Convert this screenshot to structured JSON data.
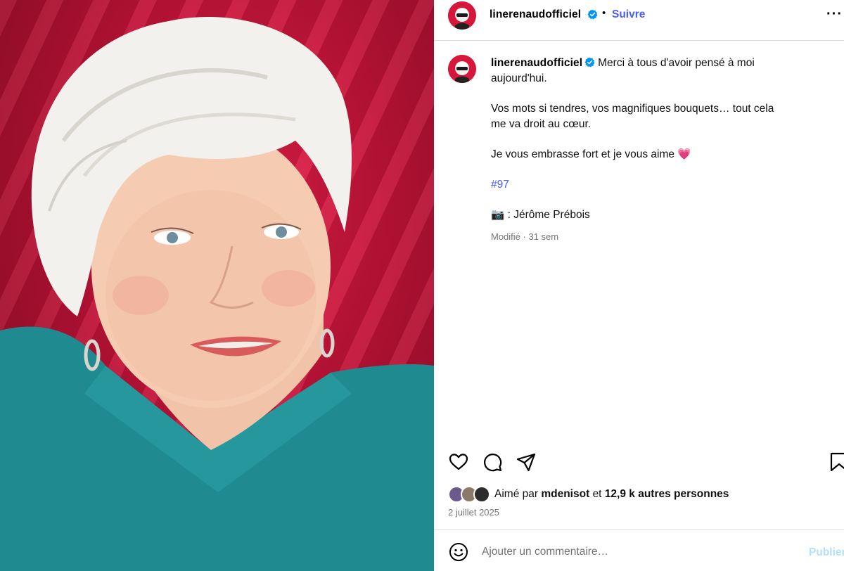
{
  "post": {
    "header": {
      "username": "linerenaudofficiel",
      "separator": "•",
      "follow_label": "Suivre",
      "more_label": "···",
      "avatar_icon": "profile-avatar-icon",
      "verified_icon": "verified-badge-icon"
    },
    "caption": {
      "username": "linerenaudofficiel",
      "first_line": "Merci à tous d'avoir pensé à moi aujourd'hui.",
      "paragraph_2": "Vos mots si tendres, vos magnifiques bouquets… tout cela me va droit au cœur.",
      "paragraph_3": "Je vous embrasse fort et je vous aime",
      "heart_emoji": "💗",
      "hashtag": "#97",
      "credit_emoji": "📷",
      "credit_text": " : Jérôme Prébois",
      "edited_label": "Modifié",
      "time_ago": "31 sem"
    },
    "actions": {
      "like_icon": "heart-icon",
      "comment_icon": "comment-icon",
      "share_icon": "share-icon",
      "save_icon": "bookmark-icon"
    },
    "likes": {
      "prefix": "Aimé par",
      "liker": "mdenisot",
      "conjunction": "et",
      "others": "12,9 k autres personnes"
    },
    "date": "2 juillet 2025",
    "comment_box": {
      "placeholder": "Ajouter un commentaire…",
      "publish_label": "Publier",
      "emoji_icon": "emoji-icon"
    }
  },
  "colors": {
    "link_blue": "#4a5df9",
    "brand_red": "#d6163a",
    "muted_text": "#737373",
    "publish_disabled": "#b2dffc",
    "divider": "#dbdbdb"
  }
}
